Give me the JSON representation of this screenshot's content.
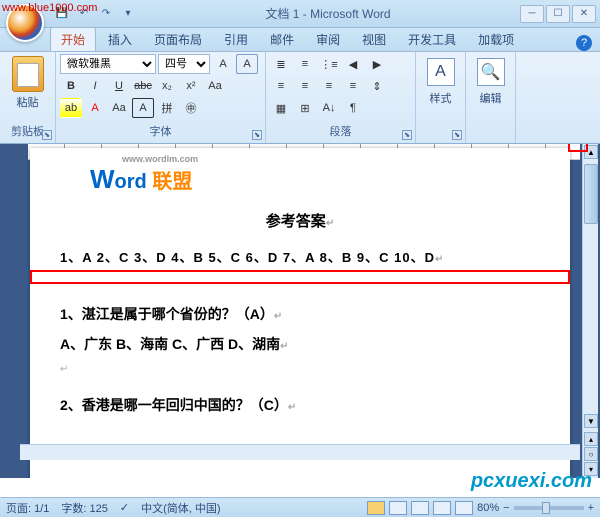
{
  "watermarks": {
    "top_left": "www.blue1000.com",
    "bottom_right": "pcxuexi.com"
  },
  "title": "文档 1 - Microsoft Word",
  "tabs": [
    "开始",
    "插入",
    "页面布局",
    "引用",
    "邮件",
    "审阅",
    "视图",
    "开发工具",
    "加载项"
  ],
  "active_tab": 0,
  "clipboard": {
    "paste": "粘贴",
    "label": "剪贴板"
  },
  "font": {
    "family": "微软雅黑",
    "size": "四号",
    "label": "字体"
  },
  "paragraph": {
    "label": "段落"
  },
  "styles": {
    "label": "样式"
  },
  "editing": {
    "label": "编辑"
  },
  "logo": {
    "sub": "www.wordlm.com",
    "w": "W",
    "ord": "ord",
    "cn": "联盟"
  },
  "document": {
    "title": "参考答案",
    "answers": "1、A  2、C  3、D  4、B  5、C  6、D  7、A  8、B  9、C  10、D",
    "q1": "1、湛江是属于哪个省份的？（A）",
    "q1_opts": "A、广东    B、海南    C、广西    D、湖南",
    "q2": "2、香港是哪一年回归中国的？（C）"
  },
  "status": {
    "page": "页面: 1/1",
    "words": "字数: 125",
    "lang": "中文(简体, 中国)",
    "zoom": "80%"
  }
}
